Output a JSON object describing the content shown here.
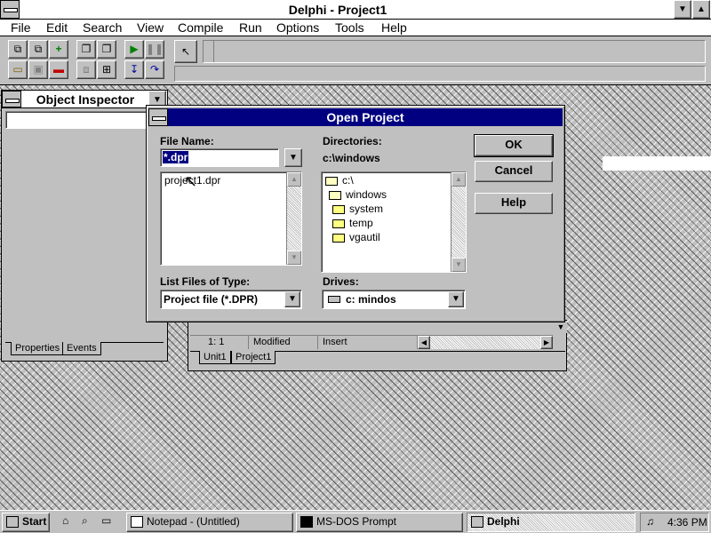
{
  "main_window": {
    "title": "Delphi - Project1"
  },
  "menu": [
    "File",
    "Edit",
    "Search",
    "View",
    "Compile",
    "Run",
    "Options",
    "Tools",
    "Help"
  ],
  "object_inspector": {
    "title": "Object Inspector",
    "tabs": [
      "Properties",
      "Events"
    ]
  },
  "editor": {
    "status": {
      "position": "1:  1",
      "state": "Modified",
      "mode": "Insert"
    },
    "tabs": [
      "Unit1",
      "Project1"
    ]
  },
  "dialog": {
    "title": "Open Project",
    "file_name_label": "File Name:",
    "file_name_value": "*.dpr",
    "files": [
      "project1.dpr"
    ],
    "list_type_label": "List Files of Type:",
    "list_type_value": "Project file (*.DPR)",
    "directories_label": "Directories:",
    "current_dir": "c:\\windows",
    "dirs": [
      "c:\\",
      "windows",
      "system",
      "temp",
      "vgautil"
    ],
    "drives_label": "Drives:",
    "drive_value": "c: mindos",
    "buttons": {
      "ok": "OK",
      "cancel": "Cancel",
      "help": "Help"
    }
  },
  "taskbar": {
    "start": "Start",
    "tasks": [
      "Notepad - (Untitled)",
      "MS-DOS Prompt",
      "Delphi"
    ],
    "clock": "4:36 PM"
  },
  "colors": {
    "title_active": "#000080",
    "face": "#c0c0c0"
  }
}
